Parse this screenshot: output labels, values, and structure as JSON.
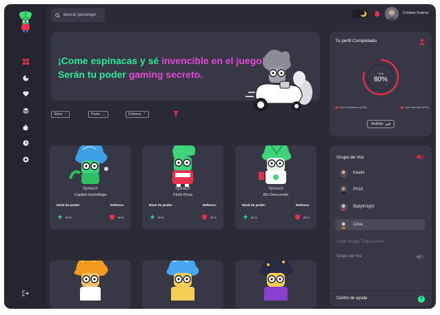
{
  "search": {
    "placeholder": "Buscar personaje"
  },
  "user": {
    "name": "Cristian Suarez"
  },
  "hero": {
    "line1_part1": "¡Come espinacas y sé ",
    "line1_part2": "invencible en el juego!",
    "line2_part1": "Serán tu poder ",
    "line2_part2": "gaming secreto."
  },
  "filters": [
    {
      "label": "Skins"
    },
    {
      "label": "Poder"
    },
    {
      "label": "Defensa"
    }
  ],
  "cards": [
    {
      "name": "Spinach",
      "subtitle": "Capitán Azulráfaga",
      "power_label": "Nivel de poder:",
      "defense_label": "Defensa:",
      "power": "85 %",
      "defense": "85 %"
    },
    {
      "name": "Spinach",
      "subtitle": "Fénix Rosa",
      "power_label": "Nivel de poder:",
      "defense_label": "Defensa:",
      "power": "85 %",
      "defense": "85 %"
    },
    {
      "name": "Spinach",
      "subtitle": "Bio Descuentix",
      "power_label": "Nivel de poder:",
      "defense_label": "Defensa:",
      "power": "85 %",
      "defense": "85 %"
    }
  ],
  "profile": {
    "title": "Tu perfil Completado",
    "ring_label": "Total",
    "ring_value": "80%",
    "ring_fraction": 0.8,
    "legend_left": "User eXperience",
    "legend_left_value": "(40%)",
    "legend_right": "User Interface",
    "legend_right_value": "(40%)",
    "button": "Análisis"
  },
  "voice": {
    "title": "Grupo de Voz",
    "members": [
      {
        "name": "Kaelin"
      },
      {
        "name": "PrOX"
      },
      {
        "name": "BabyKnight"
      },
      {
        "name": "Circe"
      }
    ],
    "create_group": "Crear Grupo Tropical Arte",
    "group2": "Grupo de Voz",
    "help": "Centro de ayuda",
    "help_icon": "?"
  },
  "colors": {
    "accent_green": "#2ee99a",
    "accent_pink": "#e04bd6",
    "red": "#e0314b",
    "bg": "#2b2a37",
    "panel": "#383745"
  },
  "icons": [
    "logo-spinach",
    "grid-icon",
    "pie-chart-icon",
    "heart-icon",
    "layers-icon",
    "fire-icon",
    "clock-icon",
    "settings-icon",
    "logout-icon",
    "search-icon",
    "moon-icon",
    "bell-icon",
    "funnel-icon",
    "user-icon",
    "speaker-icon",
    "bolt-icon",
    "shield-icon",
    "help-icon"
  ]
}
